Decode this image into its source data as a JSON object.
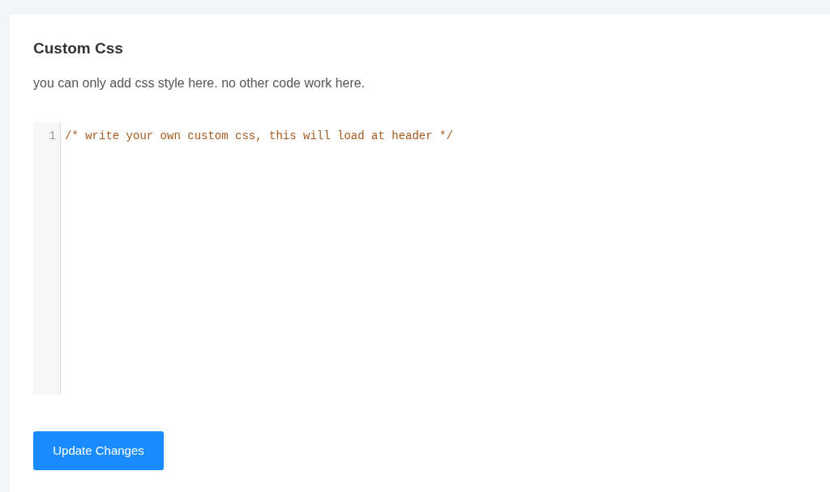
{
  "title": "Custom Css",
  "description": "you can only add css style here. no other code work here.",
  "editor": {
    "lines": [
      {
        "number": "1",
        "text": "/* write your own custom css, this will load at header */",
        "kind": "comment"
      }
    ]
  },
  "button": {
    "label": "Update Changes"
  }
}
